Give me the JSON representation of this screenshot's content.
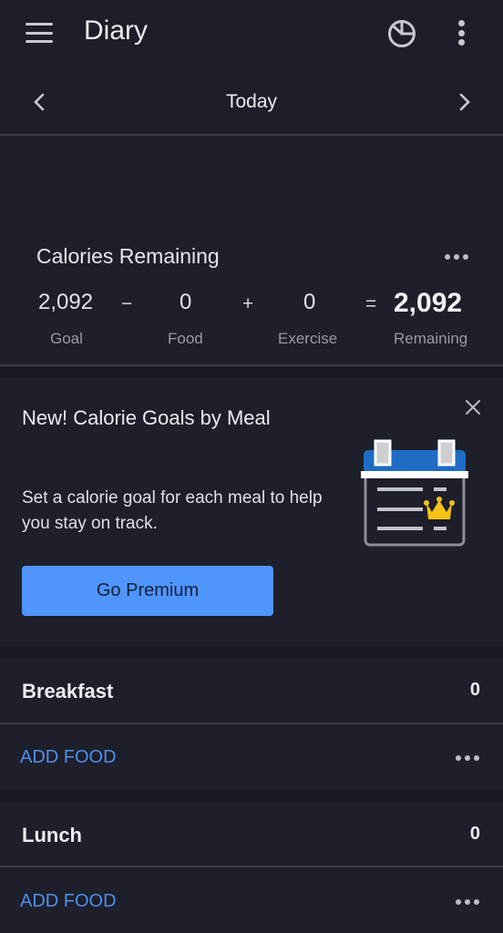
{
  "header": {
    "title": "Diary",
    "icons": [
      "menu-icon",
      "pie-chart-icon",
      "more-vertical-icon"
    ]
  },
  "date_nav": {
    "label": "Today",
    "prev_icon": "chevron-left-icon",
    "next_icon": "chevron-right-icon"
  },
  "calories": {
    "title": "Calories Remaining",
    "goal": {
      "value": "2,092",
      "label": "Goal"
    },
    "minus": "−",
    "food": {
      "value": "0",
      "label": "Food"
    },
    "plus": "+",
    "exercise": {
      "value": "0",
      "label": "Exercise"
    },
    "equals": "=",
    "remaining": {
      "value": "2,092",
      "label": "Remaining"
    }
  },
  "promo": {
    "title": "New! Calorie Goals by Meal",
    "body": "Set a calorie goal for each meal to help you stay on track.",
    "button_label": "Go Premium",
    "colors": {
      "button": "#4f95fb",
      "calendar_header": "#1e6cc4",
      "crown": "#f5c116"
    }
  },
  "meals": [
    {
      "name": "Breakfast",
      "calories": "0",
      "add_label": "ADD FOOD"
    },
    {
      "name": "Lunch",
      "calories": "0",
      "add_label": "ADD FOOD"
    }
  ],
  "colors": {
    "accent_link": "#4f8fe8",
    "background": "#1d1f2a"
  }
}
